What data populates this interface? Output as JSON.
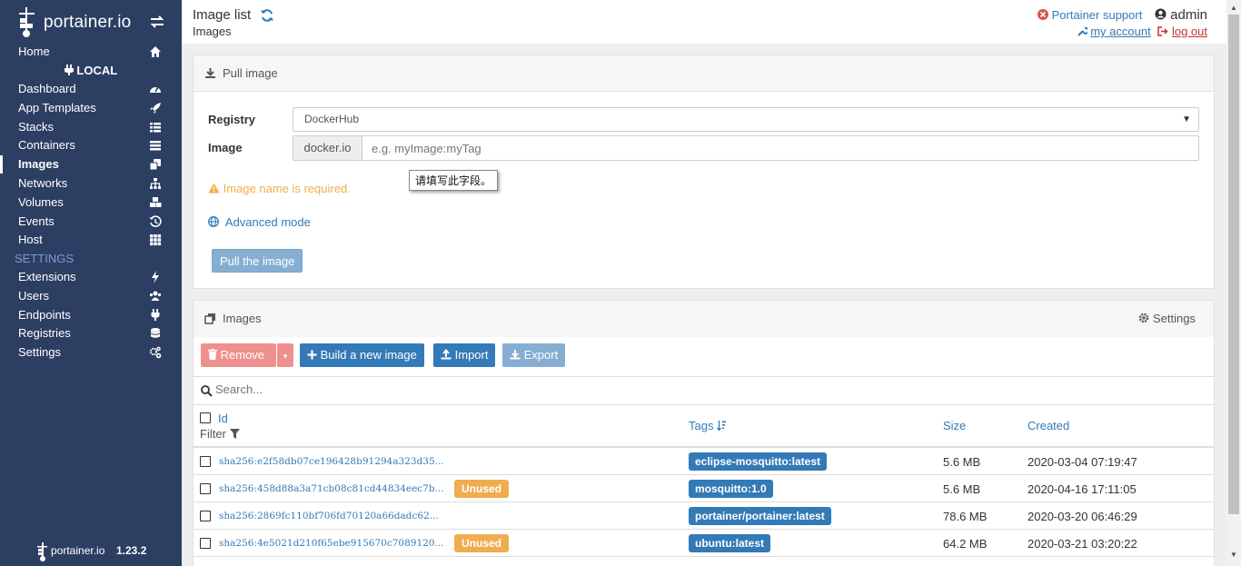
{
  "brand": {
    "name": "portainer.io"
  },
  "sidebar": {
    "home": "Home",
    "endpoint": "LOCAL",
    "items": [
      {
        "label": "Dashboard",
        "icon": "tachometer-icon"
      },
      {
        "label": "App Templates",
        "icon": "rocket-icon"
      },
      {
        "label": "Stacks",
        "icon": "th-list-icon"
      },
      {
        "label": "Containers",
        "icon": "list-icon"
      },
      {
        "label": "Images",
        "icon": "clone-icon"
      },
      {
        "label": "Networks",
        "icon": "sitemap-icon"
      },
      {
        "label": "Volumes",
        "icon": "cubes-icon"
      },
      {
        "label": "Events",
        "icon": "history-icon"
      },
      {
        "label": "Host",
        "icon": "th-icon"
      }
    ],
    "settings_title": "SETTINGS",
    "settings_items": [
      {
        "label": "Extensions",
        "icon": "bolt-icon"
      },
      {
        "label": "Users",
        "icon": "users-icon"
      },
      {
        "label": "Endpoints",
        "icon": "plug-icon"
      },
      {
        "label": "Registries",
        "icon": "database-icon"
      },
      {
        "label": "Settings",
        "icon": "cogs-icon"
      }
    ],
    "footer_brand": "portainer.io",
    "version": "1.23.2"
  },
  "header": {
    "title": "Image list",
    "breadcrumb": "Images",
    "support": "Portainer support",
    "user": "admin",
    "my_account": "my account",
    "log_out": "log out"
  },
  "pull": {
    "title": "Pull image",
    "registry_label": "Registry",
    "registry_value": "DockerHub",
    "image_label": "Image",
    "image_prefix": "docker.io",
    "image_placeholder": "e.g. myImage:myTag",
    "tooltip": "请填写此字段。",
    "warning": "Image name is required.",
    "advanced": "Advanced mode",
    "pull_button": "Pull the image"
  },
  "images": {
    "title": "Images",
    "settings": "Settings",
    "remove": "Remove",
    "build": "Build a new image",
    "import": "Import",
    "export": "Export",
    "search_placeholder": "Search...",
    "columns": {
      "id": "Id",
      "filter": "Filter",
      "tags": "Tags",
      "size": "Size",
      "created": "Created"
    },
    "rows": [
      {
        "id": "sha256:e2f58db07ce196428b91294a323d35...",
        "unused": "",
        "tag": "eclipse-mosquitto:latest",
        "size": "5.6 MB",
        "created": "2020-03-04 07:19:47"
      },
      {
        "id": "sha256:458d88a3a71cb08c81cd44834eec7b...",
        "unused": "Unused",
        "tag": "mosquitto:1.0",
        "size": "5.6 MB",
        "created": "2020-04-16 17:11:05"
      },
      {
        "id": "sha256:2869fc110bf706fd70120a66dadc62...",
        "unused": "",
        "tag": "portainer/portainer:latest",
        "size": "78.6 MB",
        "created": "2020-03-20 06:46:29"
      },
      {
        "id": "sha256:4e5021d210f65ebe915670c7089120...",
        "unused": "Unused",
        "tag": "ubuntu:latest",
        "size": "64.2 MB",
        "created": "2020-03-21 03:20:22"
      }
    ]
  }
}
